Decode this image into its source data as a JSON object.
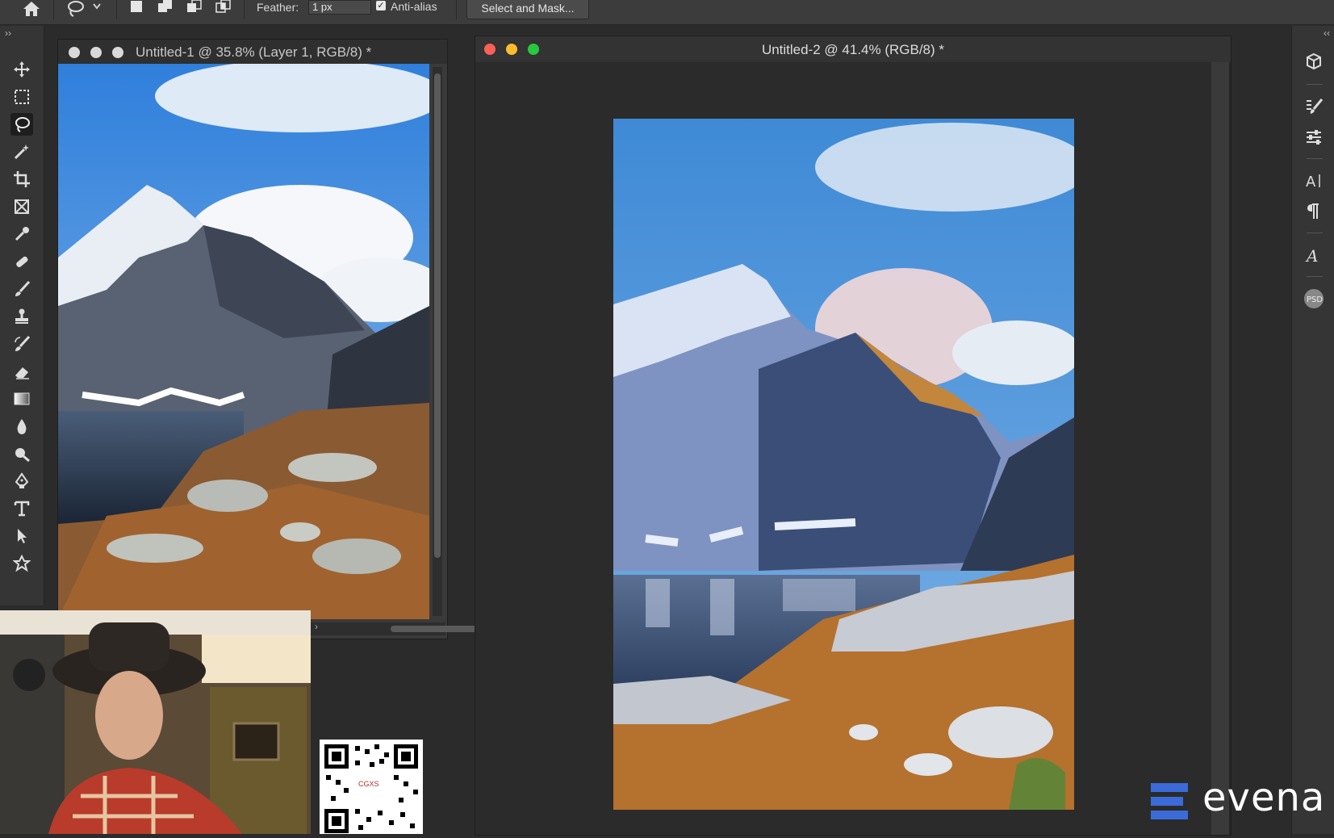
{
  "options_bar": {
    "feather_label": "Feather:",
    "feather_value": "1 px",
    "anti_alias_label": "Anti-alias",
    "anti_alias_checked": true,
    "select_mask_label": "Select and Mask..."
  },
  "toolbox": {
    "tools": [
      "move",
      "marquee",
      "lasso",
      "magic-wand",
      "crop",
      "frame",
      "eyedropper",
      "healing",
      "brush",
      "stamp",
      "history-brush",
      "eraser",
      "gradient",
      "blur",
      "dodge",
      "pen",
      "type",
      "path-select",
      "custom-shape"
    ],
    "active_tool": "lasso"
  },
  "document1": {
    "title": "Untitled-1 @ 35.8% (Layer 1, RGB/8) *"
  },
  "document2": {
    "title": "Untitled-2 @ 41.4% (RGB/8) *"
  },
  "dock": {
    "icons": [
      "3d-icon",
      "brush-settings-icon",
      "properties-icon",
      "character-icon",
      "paragraph-icon",
      "glyphs-icon",
      "psd-icon"
    ]
  },
  "qr": {
    "label": "CGXS"
  },
  "watermark": {
    "text": "evena",
    "color_mark": "#3b6bd8"
  },
  "colors": {
    "accent_blue": "#3b6bd8",
    "ui_dark": "#2b2b2b",
    "panel": "#353535"
  }
}
